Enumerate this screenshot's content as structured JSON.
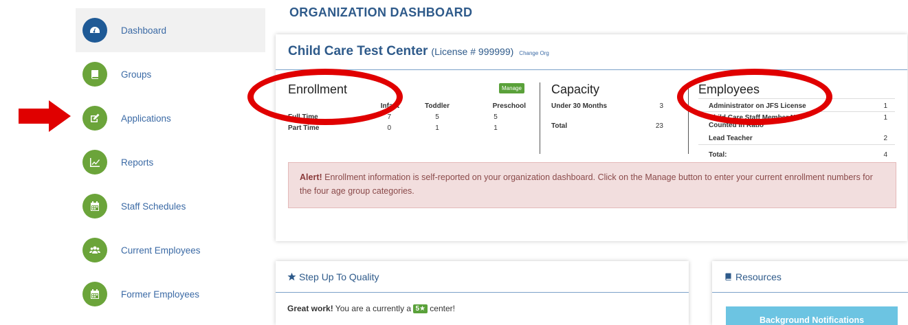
{
  "page_title": "ORGANIZATION DASHBOARD",
  "sidebar": {
    "items": [
      {
        "label": "Dashboard",
        "icon": "dashboard-icon",
        "active": true
      },
      {
        "label": "Groups",
        "icon": "book-icon"
      },
      {
        "label": "Applications",
        "icon": "edit-icon"
      },
      {
        "label": "Reports",
        "icon": "chart-icon"
      },
      {
        "label": "Staff Schedules",
        "icon": "calendar-icon"
      },
      {
        "label": "Current Employees",
        "icon": "users-icon"
      },
      {
        "label": "Former Employees",
        "icon": "calendar-icon"
      }
    ]
  },
  "org": {
    "name": "Child Care Test Center",
    "license": "(License # 999999)",
    "change_label": "Change Org"
  },
  "enrollment": {
    "title": "Enrollment",
    "manage_label": "Manage",
    "columns": [
      "Infant",
      "Toddler",
      "Preschool"
    ],
    "rows": [
      {
        "label": "Full Time",
        "values": [
          "7",
          "5",
          "5"
        ]
      },
      {
        "label": "Part Time",
        "values": [
          "0",
          "1",
          "1"
        ]
      }
    ]
  },
  "capacity": {
    "title": "Capacity",
    "rows": [
      {
        "label": "Under 30 Months",
        "value": "3"
      },
      {
        "label": "Total",
        "value": "23"
      }
    ]
  },
  "employees": {
    "title": "Employees",
    "rows": [
      {
        "label": "Administrator on JFS License",
        "value": "1"
      },
      {
        "label": "Child Care Staff Member Not Counted In Ratio",
        "value": "1"
      },
      {
        "label": "Lead Teacher",
        "value": "2"
      },
      {
        "label": "Total:",
        "value": "4"
      }
    ]
  },
  "alert": {
    "strong": "Alert!",
    "text": " Enrollment information is self-reported on your organization dashboard. Click on the Manage button to enter your current enrollment numbers for the four age group categories."
  },
  "sutq": {
    "title": "Step Up To Quality",
    "great": "Great work!",
    "text_before": " You are a currently a ",
    "badge": "5",
    "text_after": " center!"
  },
  "resources": {
    "title": "Resources",
    "button_label": "Background Notifications"
  },
  "colors": {
    "active_nav": "#1f5a96",
    "nav_icon": "#6ba43a",
    "brand_blue": "#2e5a8a",
    "annotation_red": "#e00000",
    "alert_bg": "#f2dede"
  }
}
